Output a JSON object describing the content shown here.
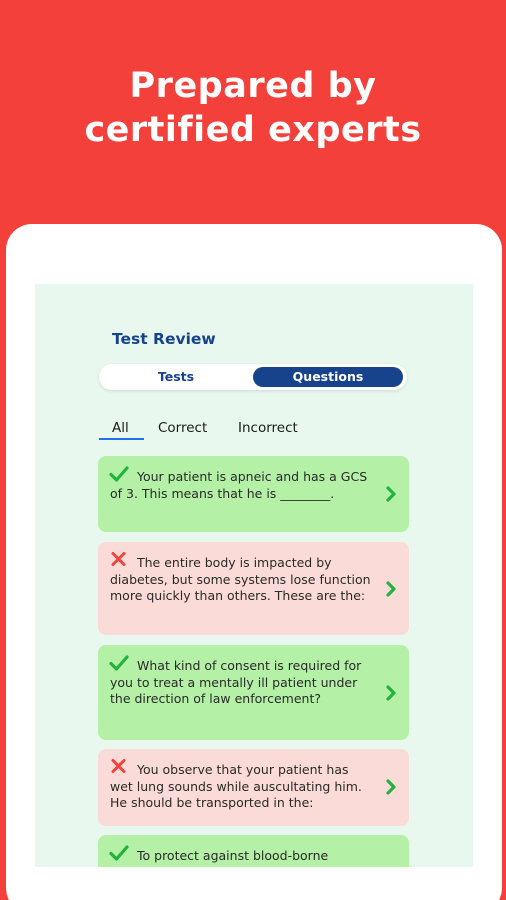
{
  "promo": {
    "line1": "Prepared by",
    "line2": "certified experts"
  },
  "review": {
    "title": "Test Review",
    "tabs": {
      "tests": "Tests",
      "questions": "Questions",
      "active": "Questions"
    },
    "filters": {
      "all": "All",
      "correct": "Correct",
      "incorrect": "Incorrect",
      "active": "All"
    }
  },
  "questions": [
    {
      "status": "correct",
      "text": "Your patient is apneic and has a GCS of 3. This means that he is ________."
    },
    {
      "status": "incorrect",
      "text": "The entire body is impacted by diabetes, but some systems lose function more quickly than others. These are the:"
    },
    {
      "status": "correct",
      "text": "What kind of consent is required for you to treat a mentally ill patient under the direction of law enforcement?"
    },
    {
      "status": "incorrect",
      "text": "You observe that your patient has wet lung sounds while auscultating him. He should be transported in the:"
    },
    {
      "status": "correct",
      "text": "To protect against blood-borne"
    }
  ],
  "colors": {
    "brand_red": "#f4403a",
    "navy": "#17428c",
    "correct_bg": "#b4f0a6",
    "incorrect_bg": "#fadbd8",
    "check_green": "#21b43c",
    "cross_red": "#f0453c"
  },
  "icons": {
    "correct": "check-icon",
    "incorrect": "cross-icon",
    "open": "chevron-right-icon"
  }
}
